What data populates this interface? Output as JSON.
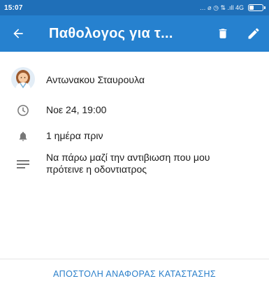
{
  "status_bar": {
    "time": "15:07",
    "icons_text": "… ⌀ ◷ ⇅ .ıll 4G"
  },
  "app_bar": {
    "title": "Παθολογος για τ...",
    "back_icon": "arrow-left-icon",
    "delete_icon": "trash-icon",
    "edit_icon": "pencil-icon"
  },
  "details": {
    "doctor_name": "Αντωνακου Σταυρουλα",
    "datetime": "Νοε 24, 19:00",
    "reminder": "1 ημέρα πριν",
    "notes": "Να πάρω μαζί την αντιβιωση που μου πρότεινε η οδοντιατρος"
  },
  "footer": {
    "report_button": "ΑΠΟΣΤΟΛΗ ΑΝΑΦΟΡΑΣ ΚΑΤΑΣΤΑΣΗΣ"
  },
  "colors": {
    "status_bar": "#1f6fb8",
    "app_bar": "#2681cf",
    "accent": "#2a7fca",
    "icon_grey": "#777777"
  }
}
